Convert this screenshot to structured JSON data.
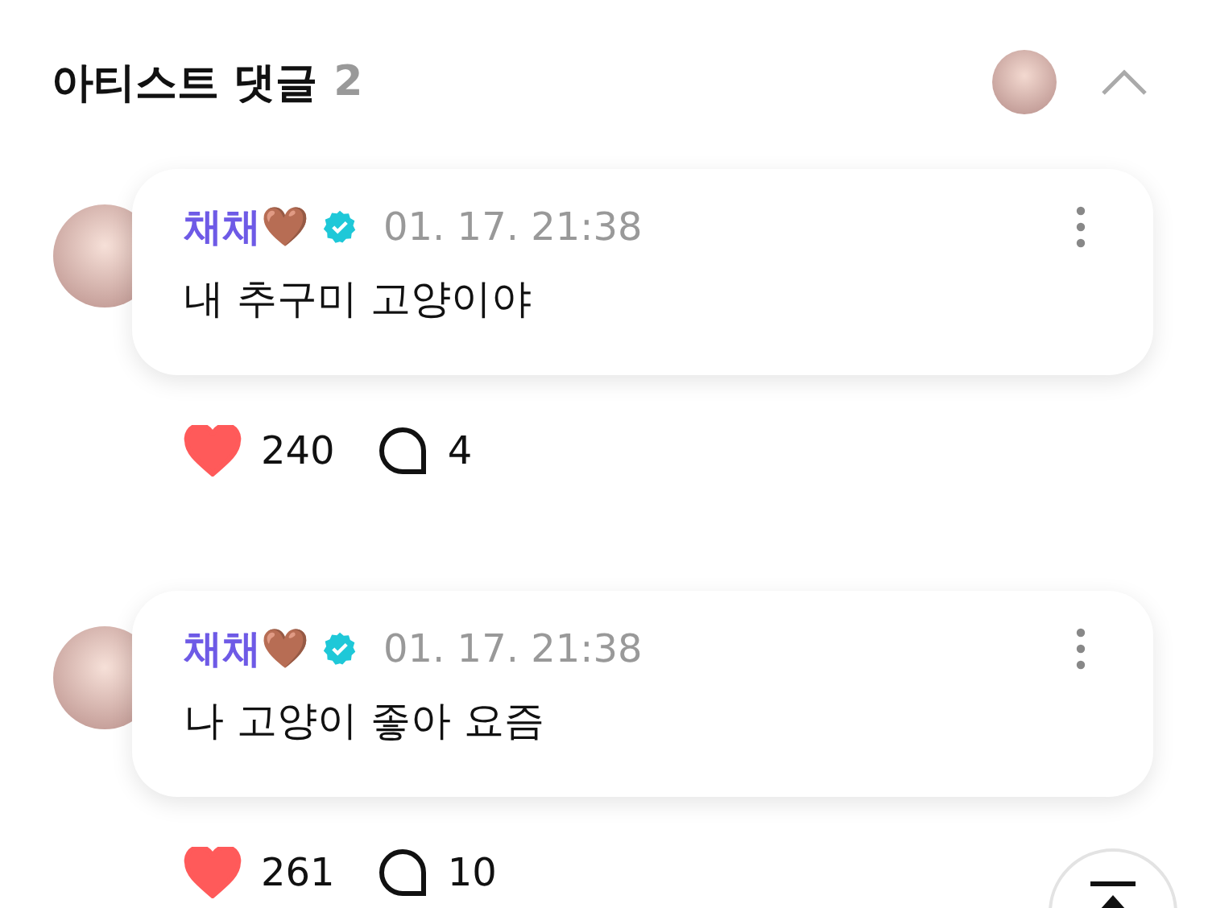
{
  "header": {
    "title": "아티스트 댓글",
    "count": "2",
    "expanded": true
  },
  "comments": [
    {
      "author": "채채🤎",
      "verified": true,
      "time": "01. 17. 21:38",
      "text": "내 추구미 고양이야",
      "likes": "240",
      "liked": true,
      "replies": "4"
    },
    {
      "author": "채채🤎",
      "verified": true,
      "time": "01. 17. 21:38",
      "text": "나 고양이 좋아 요즘",
      "likes": "261",
      "liked": true,
      "replies": "10"
    }
  ]
}
